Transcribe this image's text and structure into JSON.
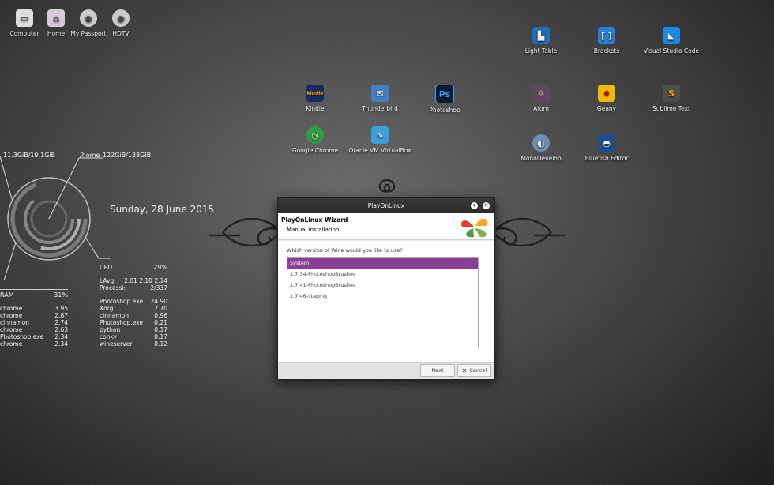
{
  "desktop_icons_top": [
    {
      "label": "Computer",
      "icon": "computer-icon"
    },
    {
      "label": "Home",
      "icon": "home-folder-icon"
    },
    {
      "label": "My Passport",
      "icon": "drive-icon"
    },
    {
      "label": "HDTV",
      "icon": "drive-icon"
    }
  ],
  "app_icons": [
    {
      "label": "Light Table",
      "icon": "lighttable-icon",
      "color": "#1f6fb5"
    },
    {
      "label": "Brackets",
      "icon": "brackets-icon",
      "color": "#2a7fd4"
    },
    {
      "label": "Visual Studio Code",
      "icon": "vscode-icon",
      "color": "#1e88e5"
    },
    {
      "label": "Kindle",
      "icon": "kindle-icon",
      "color": "#1a2a66"
    },
    {
      "label": "Thunderbird",
      "icon": "thunderbird-icon",
      "color": "#3f7fc2"
    },
    {
      "label": "Photoshop",
      "icon": "photoshop-icon",
      "color": "#0b1a33"
    },
    {
      "label": "Atom",
      "icon": "atom-icon",
      "color": "#5a4a5a"
    },
    {
      "label": "Geany",
      "icon": "geany-icon",
      "color": "#f2b807"
    },
    {
      "label": "Sublime Text",
      "icon": "sublime-icon",
      "color": "#4e4e4e"
    },
    {
      "label": "Google Chrome",
      "icon": "chrome-icon",
      "color": "#2e9e44"
    },
    {
      "label": "Oracle VM VirtualBox",
      "icon": "virtualbox-icon",
      "color": "#3aa0d8"
    },
    {
      "label": "MonoDevelop",
      "icon": "monodevelop-icon",
      "color": "#6c8fb6"
    },
    {
      "label": "Bluefish Editor",
      "icon": "bluefish-icon",
      "color": "#1b4f8c"
    }
  ],
  "conky": {
    "mem_usage": "11.3GiB/19.1GiB",
    "home_label": "/home",
    "home_usage": "122GiB/138GiB",
    "date": "Sunday, 28 June 2015",
    "ram_label": "RAM",
    "ram_pct": "31%",
    "ram_procs": [
      {
        "name": "chrome",
        "val": "3.95"
      },
      {
        "name": "chrome",
        "val": "2.87"
      },
      {
        "name": "cinnamon",
        "val": "2.74"
      },
      {
        "name": "chrome",
        "val": "2.63"
      },
      {
        "name": "Photoshop.exe",
        "val": "2.34"
      },
      {
        "name": "chrome",
        "val": "2.34"
      }
    ],
    "cpu_label": "CPU",
    "cpu_pct": "29%",
    "lavg_label": "LAvg:",
    "lavg_val": "2.01 2.10 2.14",
    "processi_label": "Processi:",
    "processi_val": "2/337",
    "cpu_procs": [
      {
        "name": "Photoshop.exe",
        "val": "24.90"
      },
      {
        "name": "Xorg",
        "val": "2.70"
      },
      {
        "name": "cinnamon",
        "val": "0.96"
      },
      {
        "name": "Photoshop.exe",
        "val": "0.21"
      },
      {
        "name": "python",
        "val": "0.17"
      },
      {
        "name": "conky",
        "val": "0.17"
      },
      {
        "name": "wineserver",
        "val": "0.12"
      }
    ]
  },
  "dialog": {
    "window_title": "PlayOnLinux",
    "header_title": "PlayOnLinux Wizard",
    "header_subtitle": "Manual installation",
    "question": "Which version of Wine would you like to use?",
    "options": [
      "System",
      "1.7.34-PhotoshopBrushes",
      "1.7.41-PhotoshopBrushes",
      "1.7.46-staging"
    ],
    "selected_index": 0,
    "next_label": "Next",
    "cancel_label": "Cancel",
    "accent": "#8a3f96"
  }
}
